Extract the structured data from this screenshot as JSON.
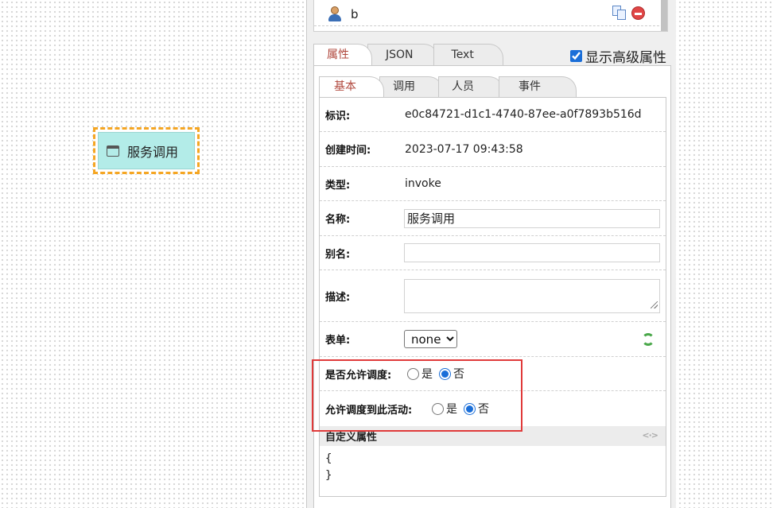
{
  "canvas": {
    "node_label": "服务调用"
  },
  "outline": {
    "user_label": "b"
  },
  "top_tabs": [
    "属性",
    "JSON",
    "Text"
  ],
  "advanced": {
    "label": "显示高级属性",
    "checked": true
  },
  "sub_tabs": [
    "基本",
    "调用",
    "人员",
    "事件"
  ],
  "form": {
    "id_label": "标识:",
    "id_value": "e0c84721-d1c1-4740-87ee-a0f7893b516d",
    "created_label": "创建时间:",
    "created_value": "2023-07-17 09:43:58",
    "type_label": "类型:",
    "type_value": "invoke",
    "name_label": "名称:",
    "name_value": "服务调用",
    "alias_label": "别名:",
    "alias_value": "",
    "desc_label": "描述:",
    "desc_value": "",
    "form_label": "表单:",
    "form_selected": "none",
    "allow_dispatch_label": "是否允许调度:",
    "allow_dispatch_to_label": "允许调度到此活动:",
    "yes": "是",
    "no": "否",
    "allow_dispatch_value": "否",
    "allow_dispatch_to_value": "否"
  },
  "custom": {
    "title": "自定义属性",
    "code_icon": "<·>",
    "body": "{\n}"
  }
}
